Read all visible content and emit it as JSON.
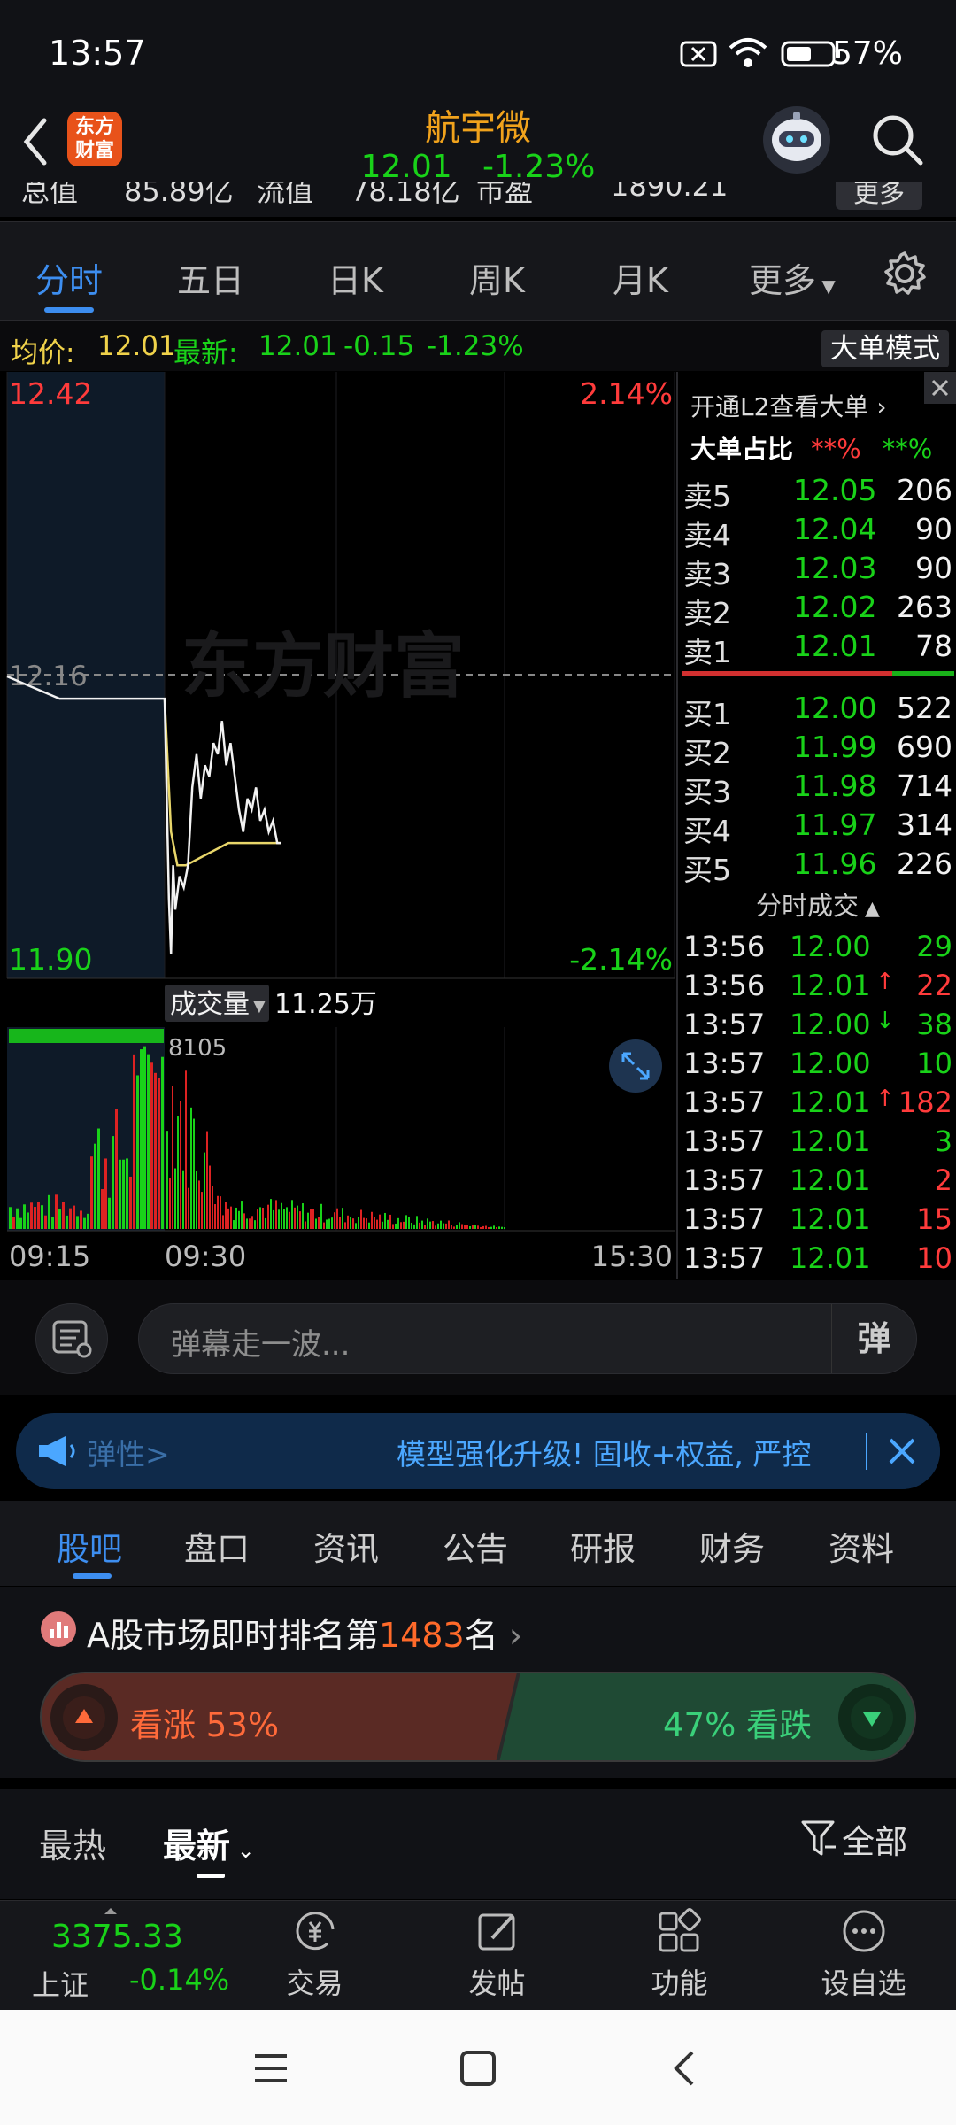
{
  "status_bar": {
    "time": "13:57",
    "battery": "57%"
  },
  "header": {
    "logo_text_1": "东方",
    "logo_text_2": "财富",
    "stock_name": "航宇微",
    "price": "12.01",
    "change_pct": "-1.23%"
  },
  "info_row": {
    "total_value_label": "总值",
    "total_value": "85.89亿",
    "float_label": "流值",
    "float_value": "78.18亿",
    "pe_label": "市盈",
    "pe_value": "1890.21",
    "more_label": "更多"
  },
  "chart_tabs": [
    "分时",
    "五日",
    "日K",
    "周K",
    "月K",
    "更多"
  ],
  "avg_row": {
    "avg_label": "均价:",
    "avg_value": "12.01",
    "latest_label": "最新:",
    "latest_value": "12.01",
    "change": "-0.15",
    "change_pct": "-1.23%",
    "bigorder_mode": "大单模式"
  },
  "chart": {
    "price_high": "12.42",
    "pct_high": "2.14%",
    "price_mid": "12.16",
    "price_low": "11.90",
    "pct_low": "-2.14%",
    "watermark": "东方财富",
    "volume_label": "成交量",
    "volume_value": "11.25万",
    "volume_max": "8105",
    "time_start": "09:15",
    "time_open": "09:30",
    "time_end": "15:30"
  },
  "chart_data": {
    "type": "line",
    "series": [
      {
        "x": [
          "09:15",
          "09:20",
          "09:25",
          "09:30",
          "09:31",
          "09:32",
          "09:33",
          "09:34",
          "09:35",
          "09:37",
          "09:39",
          "09:41",
          "09:43",
          "09:45",
          "09:47",
          "09:49",
          "09:51",
          "09:53",
          "09:55",
          "09:57",
          "09:59",
          "10:01",
          "10:03",
          "10:05",
          "10:07",
          "10:09",
          "10:11",
          "10:13",
          "10:15",
          "10:17",
          "10:19",
          "10:21",
          "10:23",
          "10:25"
        ],
        "values": [
          12.16,
          12.14,
          12.14,
          12.14,
          12.05,
          11.96,
          11.91,
          11.99,
          11.95,
          11.98,
          11.97,
          11.99,
          12.06,
          12.09,
          12.05,
          12.08,
          12.07,
          12.1,
          12.09,
          12.12,
          12.08,
          12.1,
          12.07,
          12.04,
          12.02,
          12.05,
          12.04,
          12.06,
          12.03,
          12.04,
          12.02,
          12.03,
          12.01,
          12.01
        ]
      },
      {
        "x": [
          "09:30",
          "09:33",
          "09:36",
          "09:40",
          "09:50",
          "10:00",
          "10:10",
          "10:25"
        ],
        "values": [
          12.14,
          12.02,
          11.99,
          11.99,
          12.0,
          12.01,
          12.01,
          12.01
        ]
      }
    ],
    "ylim": [
      11.9,
      12.42
    ],
    "reference": 12.16
  },
  "order_book": {
    "promo": "开通L2查看大单",
    "bigorder_label": "大单占比",
    "bigorder_buy": "**%",
    "bigorder_sell": "**%",
    "asks": [
      {
        "label": "卖5",
        "price": "12.05",
        "vol": "206"
      },
      {
        "label": "卖4",
        "price": "12.04",
        "vol": "90"
      },
      {
        "label": "卖3",
        "price": "12.03",
        "vol": "90"
      },
      {
        "label": "卖2",
        "price": "12.02",
        "vol": "263"
      },
      {
        "label": "卖1",
        "price": "12.01",
        "vol": "78"
      }
    ],
    "bids": [
      {
        "label": "买1",
        "price": "12.00",
        "vol": "522"
      },
      {
        "label": "买2",
        "price": "11.99",
        "vol": "690"
      },
      {
        "label": "买3",
        "price": "11.98",
        "vol": "714"
      },
      {
        "label": "买4",
        "price": "11.97",
        "vol": "314"
      },
      {
        "label": "买5",
        "price": "11.96",
        "vol": "226"
      }
    ]
  },
  "trades": {
    "title": "分时成交",
    "rows": [
      {
        "time": "13:56",
        "price": "12.00",
        "arrow": "",
        "vol": "29",
        "color": "green"
      },
      {
        "time": "13:56",
        "price": "12.01",
        "arrow": "↑",
        "vol": "22",
        "color": "red"
      },
      {
        "time": "13:57",
        "price": "12.00",
        "arrow": "↓",
        "vol": "38",
        "color": "green"
      },
      {
        "time": "13:57",
        "price": "12.00",
        "arrow": "",
        "vol": "10",
        "color": "green"
      },
      {
        "time": "13:57",
        "price": "12.01",
        "arrow": "↑",
        "vol": "182",
        "color": "red"
      },
      {
        "time": "13:57",
        "price": "12.01",
        "arrow": "",
        "vol": "3",
        "color": "green"
      },
      {
        "time": "13:57",
        "price": "12.01",
        "arrow": "",
        "vol": "2",
        "color": "red"
      },
      {
        "time": "13:57",
        "price": "12.01",
        "arrow": "",
        "vol": "15",
        "color": "red"
      },
      {
        "time": "13:57",
        "price": "12.01",
        "arrow": "",
        "vol": "10",
        "color": "red"
      }
    ]
  },
  "comment_bar": {
    "placeholder": "弹幕走一波...",
    "danmu_icon": "弹"
  },
  "banner": {
    "left_text": "弹性>",
    "text": "模型强化升级! 固收+权益, 严控"
  },
  "sub_tabs": [
    "股吧",
    "盘口",
    "资讯",
    "公告",
    "研报",
    "财务",
    "资料"
  ],
  "rank": {
    "prefix": "A股市场即时排名第",
    "number": "1483",
    "suffix": "名"
  },
  "vote": {
    "up_label": "看涨 53%",
    "down_label": "47% 看跌",
    "up_pct": 53,
    "down_pct": 47
  },
  "feed_tabs": {
    "hot": "最热",
    "latest": "最新",
    "filter": "全部"
  },
  "bottom_nav": {
    "index_value": "3375.33",
    "index_name": "上证",
    "index_change": "-0.14%",
    "items": [
      "交易",
      "发帖",
      "功能",
      "设自选"
    ]
  },
  "colors": {
    "accent": "#3d8ef0",
    "up": "#ff3b3b",
    "down": "#19d219",
    "name": "#f0a21c"
  }
}
